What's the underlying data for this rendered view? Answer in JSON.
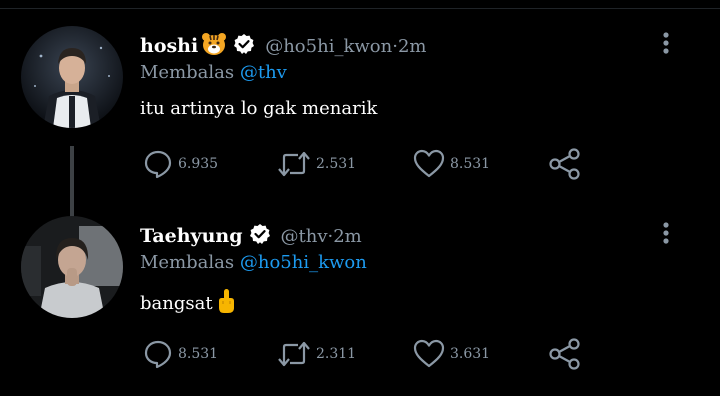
{
  "tweets": [
    {
      "name": "hoshi",
      "name_emoji": "tiger-face",
      "handle": "@ho5hi_kwon",
      "time_sep": " · ",
      "time": "2m",
      "reply_prefix": "Membalas ",
      "reply_to": "@thv",
      "text": "itu artinya lo gak menarik",
      "replies": "6.935",
      "retweets": "2.531",
      "likes": "8.531"
    },
    {
      "name": "Taehyung",
      "handle": "@thv",
      "time_sep": " · ",
      "time": "2m",
      "reply_prefix": "Membalas ",
      "reply_to": "@ho5hi_kwon",
      "text": "bangsat",
      "text_emoji": "middle-finger",
      "replies": "8.531",
      "retweets": "2.311",
      "likes": "3.631"
    }
  ],
  "icons": {
    "reply": "reply-icon",
    "retweet": "retweet-icon",
    "like": "heart-icon",
    "share": "share-icon",
    "menu": "more-vertical-icon",
    "verified": "verified-badge-icon"
  },
  "colors": {
    "background": "#000000",
    "secondary_text": "#8b98a5",
    "mention": "#1d9bf0",
    "icon": "#8b98a5"
  }
}
